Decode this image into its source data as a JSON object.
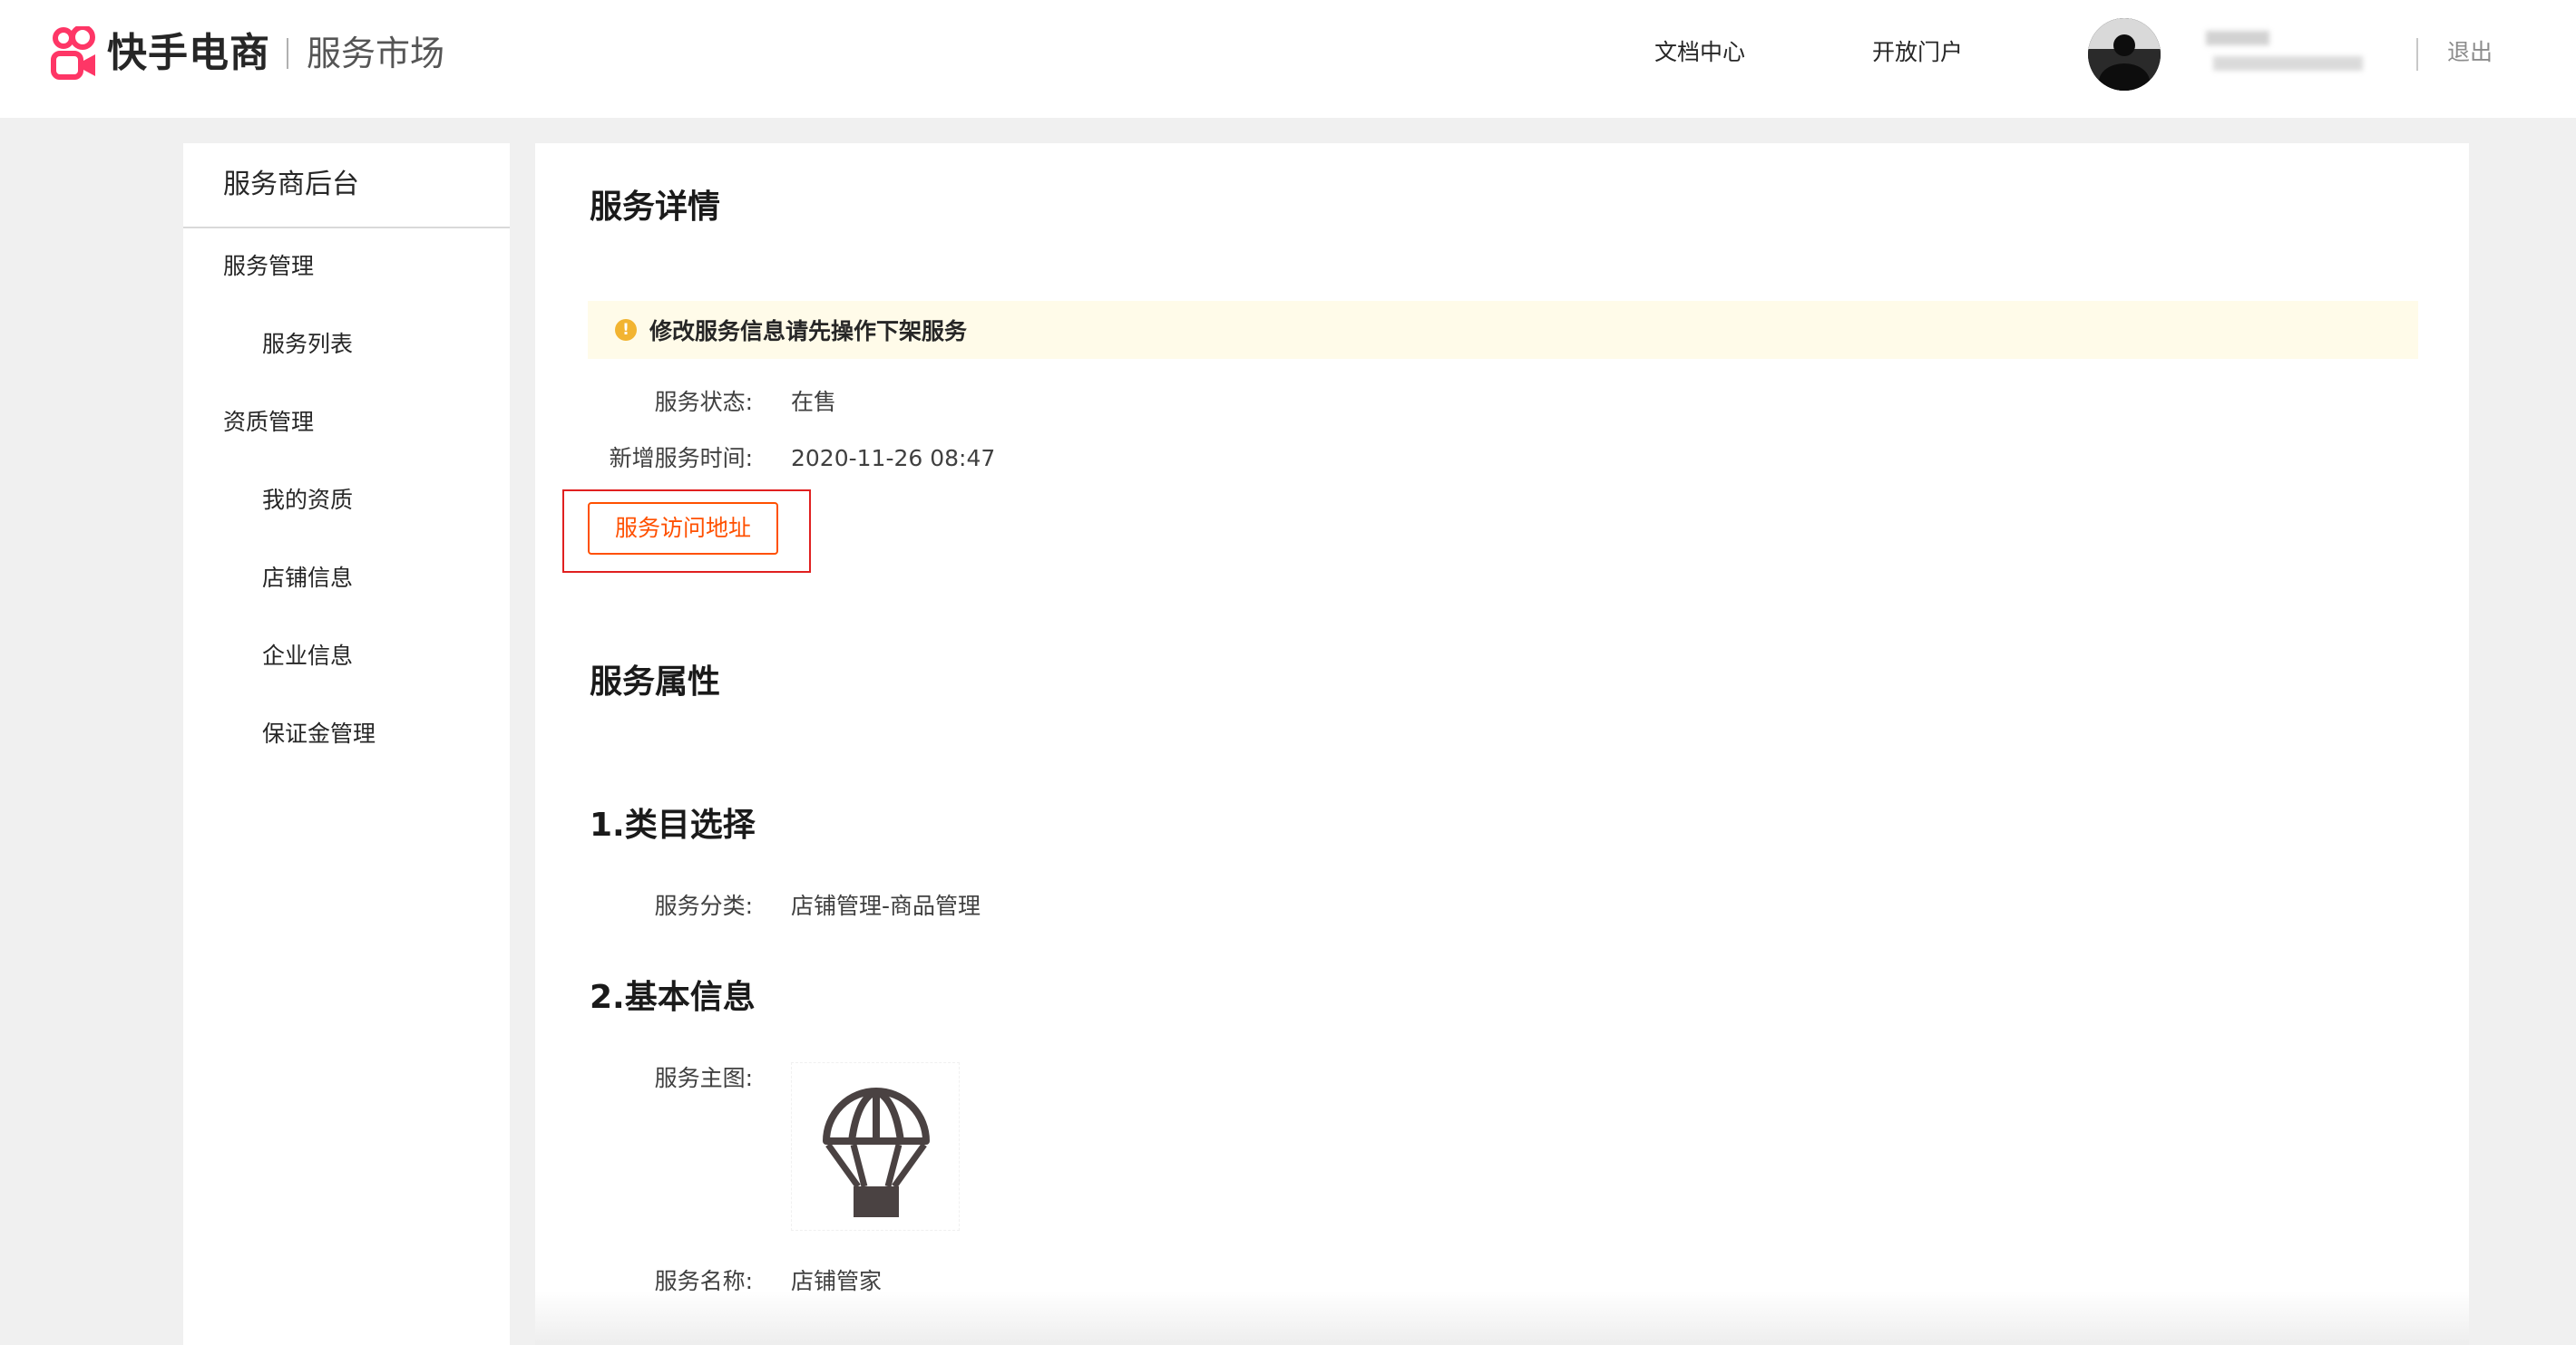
{
  "header": {
    "brand": "快手电商",
    "market": "服务市场",
    "nav": {
      "docs": "文档中心",
      "portal": "开放门户"
    },
    "logout": "退出"
  },
  "sidebar": {
    "title": "服务商后台",
    "groups": [
      {
        "label": "服务管理",
        "items": [
          "服务列表"
        ]
      },
      {
        "label": "资质管理",
        "items": [
          "我的资质",
          "店铺信息",
          "企业信息",
          "保证金管理"
        ]
      }
    ]
  },
  "main": {
    "detail_title": "服务详情",
    "notice": "修改服务信息请先操作下架服务",
    "notice_icon": "!",
    "status_label": "服务状态:",
    "status_value": "在售",
    "created_label": "新增服务时间:",
    "created_value": "2020-11-26 08:47",
    "access_button": "服务访问地址",
    "attributes_title": "服务属性",
    "section1_title": "1.类目选择",
    "category_label": "服务分类:",
    "category_value": "店铺管理-商品管理",
    "section2_title": "2.基本信息",
    "main_image_label": "服务主图:",
    "main_image_icon": "parachute-icon",
    "name_label": "服务名称:",
    "name_value": "店铺管家"
  },
  "colors": {
    "accent": "#ff5000",
    "brand_logo": "#fe3666",
    "notice_bg": "#fffbe9",
    "notice_icon": "#f2b431",
    "highlight_border": "#e02020",
    "page_bg": "#f0f0f0"
  }
}
